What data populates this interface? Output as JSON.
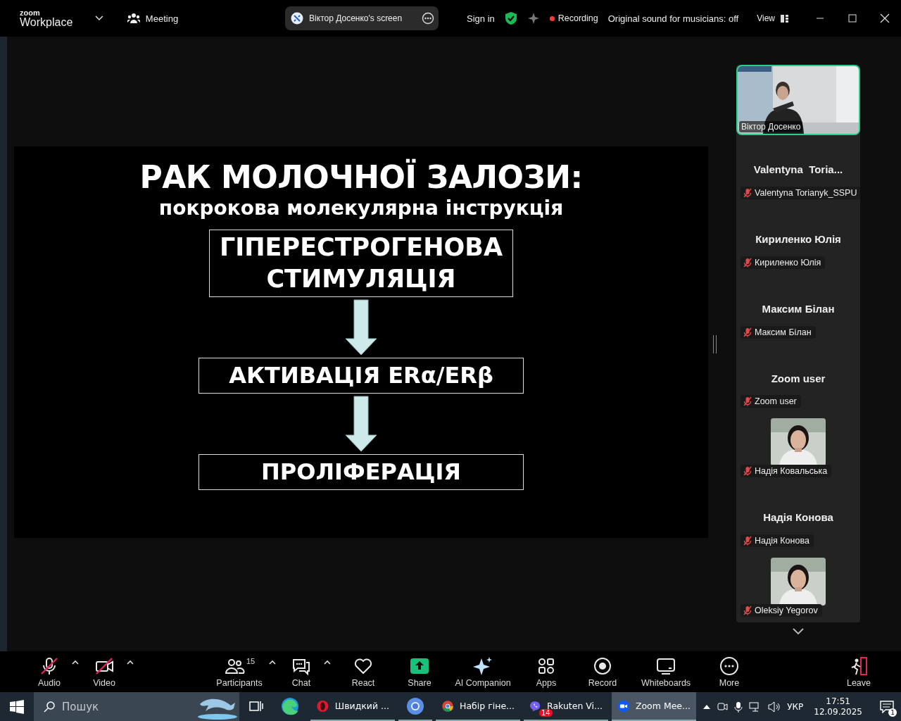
{
  "top_bar": {
    "logo_small": "zoom",
    "logo": "Workplace",
    "meeting": "Meeting",
    "share_pill": "Віктор Досенко's screen",
    "sign_in": "Sign in",
    "recording": "Recording",
    "original_sound": "Original sound for musicians: off",
    "view": "View"
  },
  "slide": {
    "title": "РАК МОЛОЧНОЇ ЗАЛОЗИ:",
    "subtitle": "покрокова молекулярна інструкція",
    "steps": [
      {
        "text": "ГІПЕРЕСТРОГЕНОВА\nСТИМУЛЯЦІЯ"
      },
      {
        "text": "АКТИВАЦІЯ ERα/ERβ"
      },
      {
        "text": "ПРОЛІФЕРАЦІЯ"
      }
    ]
  },
  "participants": [
    {
      "kind": "video",
      "name": "Віктор Досенко",
      "muted": false,
      "active": true
    },
    {
      "kind": "name",
      "display": "Valentyna  Toria...",
      "name": "Valentyna Torianyk_SSPU",
      "muted": true,
      "active": false
    },
    {
      "kind": "name",
      "display": "Кириленко Юлія",
      "name": "Кириленко Юлія",
      "muted": true,
      "active": false
    },
    {
      "kind": "name",
      "display": "Максим Білан",
      "name": "Максим Білан",
      "muted": true,
      "active": false
    },
    {
      "kind": "name",
      "display": "Zoom user",
      "name": "Zoom user",
      "muted": true,
      "active": false
    },
    {
      "name": "Надія Ковальська",
      "muted": true,
      "active": false
    },
    {
      "kind": "name",
      "display": "Надія Конова",
      "name": "Надія Конова",
      "muted": true,
      "active": false
    },
    {
      "name": "Oleksiy Yegorov",
      "muted": true,
      "active": false
    }
  ],
  "toolbar": [
    {
      "kind": "mic",
      "label": "Audio",
      "off": true,
      "caret": true
    },
    {
      "kind": "camera",
      "label": "Video",
      "off": true,
      "caret": true
    },
    {
      "kind": "people",
      "label": "Participants",
      "count": "15",
      "caret": true
    },
    {
      "kind": "chat",
      "label": "Chat",
      "caret": true
    },
    {
      "kind": "heart",
      "label": "React"
    },
    {
      "kind": "share",
      "label": "Share"
    },
    {
      "kind": "sparkle",
      "label": "AI Companion"
    },
    {
      "kind": "apps",
      "label": "Apps"
    },
    {
      "kind": "record",
      "label": "Record"
    },
    {
      "kind": "whiteboard",
      "label": "Whiteboards"
    },
    {
      "kind": "more",
      "label": "More"
    },
    {
      "kind": "leave",
      "label": "Leave"
    }
  ],
  "taskbar": {
    "search_placeholder": "Пошук",
    "apps": [
      {
        "kind": "opera",
        "label": "Швидкий ...",
        "selected": false
      },
      {
        "kind": "chromium",
        "selected": false
      },
      {
        "kind": "chrome",
        "label": "Набір гіне...",
        "selected": false
      },
      {
        "kind": "viber",
        "label": "Rakuten Vi...",
        "badge": "14",
        "selected": false
      },
      {
        "kind": "zoom",
        "label": "Zoom Mee...",
        "selected": true
      }
    ],
    "language": "УКР",
    "time": "17:51",
    "date": "12.09.2025",
    "notifications": "1"
  }
}
